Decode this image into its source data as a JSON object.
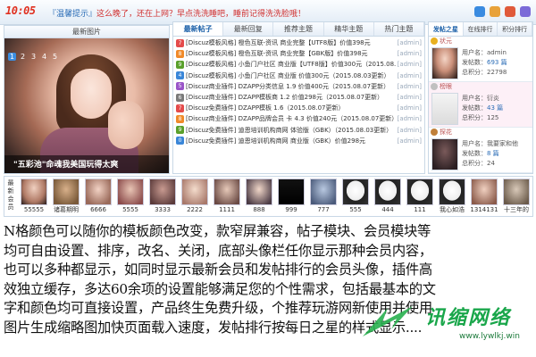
{
  "topbar": {
    "clock": "10:05",
    "notice_lead": "『温馨提示』",
    "notice": "这么晚了，还在上网？早点洗洗睡吧，睡前记得洗洗脸哦！",
    "icon_colors": [
      "#3a8be0",
      "#e8a23a",
      "#e05a3a",
      "#7a6ad8"
    ]
  },
  "slide": {
    "title": "最新图片",
    "numbers": [
      "1",
      "2",
      "3",
      "4",
      "5"
    ],
    "active": "1",
    "caption": "\"五彩池\"命魂我美国玩得太爽"
  },
  "posts": {
    "tabs": [
      "最新帖子",
      "最新回复",
      "推荐主题",
      "精华主题",
      "热门主题"
    ],
    "active_tab": "最新帖子",
    "rows": [
      {
        "badge": "7",
        "color": "#e44b4b",
        "title": "[Discuz模板风格] 橙色互联-资讯 商业完整【UTF8版】价值398元",
        "admin": "[admin]"
      },
      {
        "badge": "8",
        "color": "#f08a2a",
        "title": "[Discuz模板风格] 橙色互联-资讯 商业完整【GBK版】价值398元",
        "admin": "[admin]"
      },
      {
        "badge": "9",
        "color": "#5aa02c",
        "title": "[Discuz模板风格] 小鱼门户社区 商业版【UTF8版】价值300元（2015.08.03更",
        "admin": "[admin]"
      },
      {
        "badge": "4",
        "color": "#3a86d8",
        "title": "[Discuz模板风格] 小鱼门户社区 商业版 价值300元（2015.08.03更新）",
        "admin": "[admin]"
      },
      {
        "badge": "5",
        "color": "#9a55c8",
        "title": "[Discuz商业插件] DZAPP分类信息 1.9 价值400元（2015.08.07更新）",
        "admin": "[admin]"
      },
      {
        "badge": "6",
        "color": "#7a7a7a",
        "title": "[Discuz商业插件] DZAPP模板商 1.2 价值298元（2015.08.07更新）",
        "admin": "[admin]"
      },
      {
        "badge": "7",
        "color": "#e44b4b",
        "title": "[Discuz免费插件] DZAPP模板 1.6（2015.08.07更新）",
        "admin": "[admin]"
      },
      {
        "badge": "8",
        "color": "#f08a2a",
        "title": "[Discuz商业插件] DZAPP品牌会员 卡 4.3 价值240元（2015.08.07更新）",
        "admin": "[admin]"
      },
      {
        "badge": "9",
        "color": "#5aa02c",
        "title": "[Discuz免费插件] 迪恩培训机构商网 体验版（GBK）（2015.08.03更新）",
        "admin": "[admin]"
      },
      {
        "badge": "0",
        "color": "#3a86d8",
        "title": "[Discuz免费插件] 迪恩培训机构商网 商业版（GBK）价值298元",
        "admin": "[admin]"
      }
    ]
  },
  "rank": {
    "tabs": [
      "发帖之星",
      "在线排行",
      "积分排行"
    ],
    "active_tab": "发帖之星",
    "users": [
      {
        "rank": "状元",
        "medal_color": "#e8b020",
        "user_label": "用户名：",
        "user": "admin",
        "posts_label": "发帖数：",
        "posts": "693 篇",
        "points_label": "总积分：",
        "points": "22798"
      },
      {
        "rank": "榜眼",
        "medal_color": "#c0c0c0",
        "user_label": "用户名：",
        "user": "衍炎",
        "posts_label": "发帖数：",
        "posts": "43 篇",
        "points_label": "总积分：",
        "points": "125"
      },
      {
        "rank": "探花",
        "medal_color": "#c0803a",
        "user_label": "用户名：",
        "user": "我要家和他",
        "posts_label": "发帖数：",
        "posts": "8 篇",
        "points_label": "总积分：",
        "points": "24"
      }
    ]
  },
  "members": {
    "label": "最新会员",
    "list": [
      "55555",
      "诸葛期明",
      "6666",
      "5555",
      "3333",
      "2222",
      "1111",
      "888",
      "999",
      "777",
      "555",
      "444",
      "111",
      "我心如浩",
      "1314131",
      "十三年的"
    ]
  },
  "description": [
    "N格颜色可以随你的模板颜色改变，款窄屏兼容，帖子模块、会员模块等",
    "均可自由设置、排序，改名、关闭，底部头像栏任你显示那种会员内容，",
    "也可以多种都显示，如同时显示最新会员和发帖排行的会员头像，插件高",
    "效独立缓存，多达60余项的设置能够满足您的个性需求，包括最基本的文",
    "字和颜色均可直接设置，产品终生免费升级，个推荐玩游网新使用并使用",
    "图片生成缩略图加快页面载入速度，发帖排行按每日之星的样式显示...."
  ],
  "watermark": {
    "logo": "讯缩网络",
    "url": "www.lywlkj.win"
  }
}
